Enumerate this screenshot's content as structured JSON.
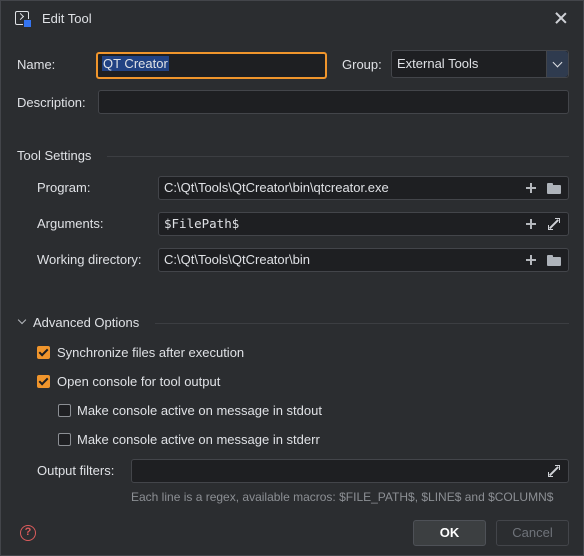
{
  "window": {
    "title": "Edit Tool"
  },
  "form": {
    "name_label": "Name:",
    "name_value": "QT Creator",
    "group_label": "Group:",
    "group_value": "External Tools",
    "description_label": "Description:",
    "description_value": ""
  },
  "tool_settings": {
    "title": "Tool Settings",
    "program_label": "Program:",
    "program_value": "C:\\Qt\\Tools\\QtCreator\\bin\\qtcreator.exe",
    "arguments_label": "Arguments:",
    "arguments_value": "$FilePath$",
    "workdir_label": "Working directory:",
    "workdir_value": "C:\\Qt\\Tools\\QtCreator\\bin"
  },
  "advanced": {
    "title": "Advanced Options",
    "sync_label": "Synchronize files after execution",
    "sync_checked": true,
    "console_label": "Open console for tool output",
    "console_checked": true,
    "stdout_label": "Make console active on message in stdout",
    "stdout_checked": false,
    "stderr_label": "Make console active on message in stderr",
    "stderr_checked": false,
    "filters_label": "Output filters:",
    "filters_value": "",
    "hint": "Each line is a regex, available macros: $FILE_PATH$, $LINE$ and $COLUMN$"
  },
  "footer": {
    "ok_label": "OK",
    "cancel_label": "Cancel"
  },
  "colors": {
    "accent": "#f0952c",
    "background": "#2b2d30",
    "input_bg": "#1e1f22",
    "help": "#db5c5c"
  }
}
